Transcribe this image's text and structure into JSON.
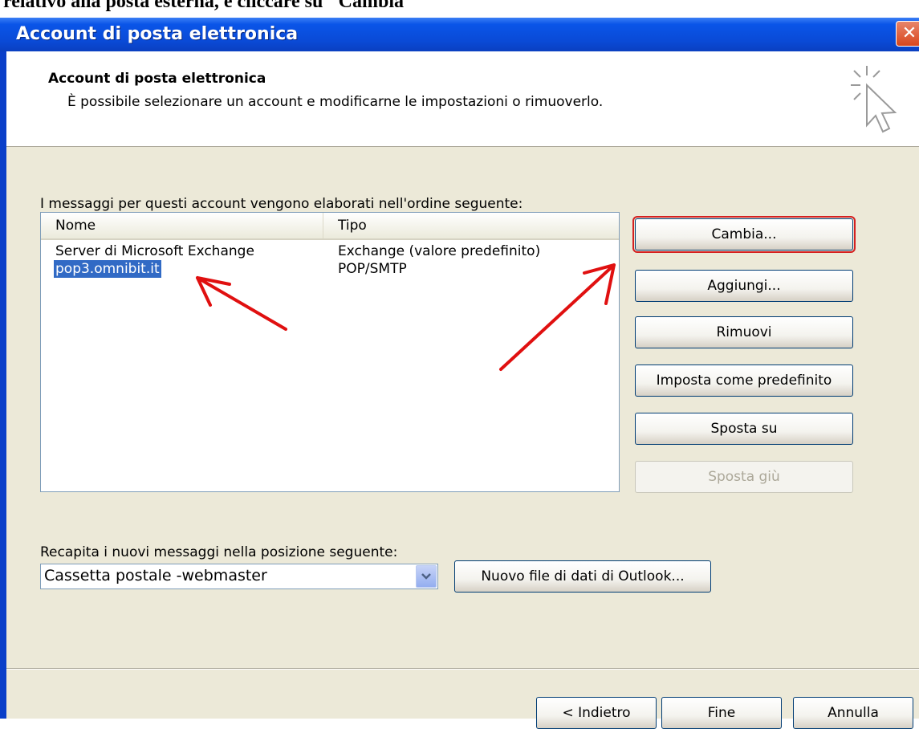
{
  "document_text": "relativo alla posta esterna, e cliccare su \"Cambia\"",
  "window": {
    "title": "Account di posta elettronica",
    "close_glyph": "✕"
  },
  "header": {
    "title": "Account di posta elettronica",
    "subtitle": "È possibile selezionare un account e modificarne le impostazioni o rimuoverlo.",
    "icon": "wizard-cursor-icon"
  },
  "accounts": {
    "label": "I messaggi per questi account vengono elaborati nell'ordine seguente:",
    "columns": [
      "Nome",
      "Tipo"
    ],
    "rows": [
      {
        "name": "Server di Microsoft Exchange",
        "type": "Exchange (valore predefinito)"
      },
      {
        "name": "pop3.omnibit.it",
        "type": "POP/SMTP",
        "selected": true
      }
    ]
  },
  "buttons": {
    "change": "Cambia...",
    "add": "Aggiungi...",
    "remove": "Rimuovi",
    "set_default": "Imposta come predefinito",
    "move_up": "Sposta su",
    "move_down": "Sposta giù"
  },
  "delivery": {
    "label": "Recapita i nuovi messaggi nella posizione seguente:",
    "selected": "Cassetta postale -webmaster",
    "new_data_file": "Nuovo file di dati di Outlook..."
  },
  "footer": {
    "back": "< Indietro",
    "finish": "Fine",
    "cancel": "Annulla"
  },
  "colors": {
    "annotation_arrow": "#e01010",
    "selection": "#316ac5",
    "titlebar": "#0a4ad6"
  }
}
